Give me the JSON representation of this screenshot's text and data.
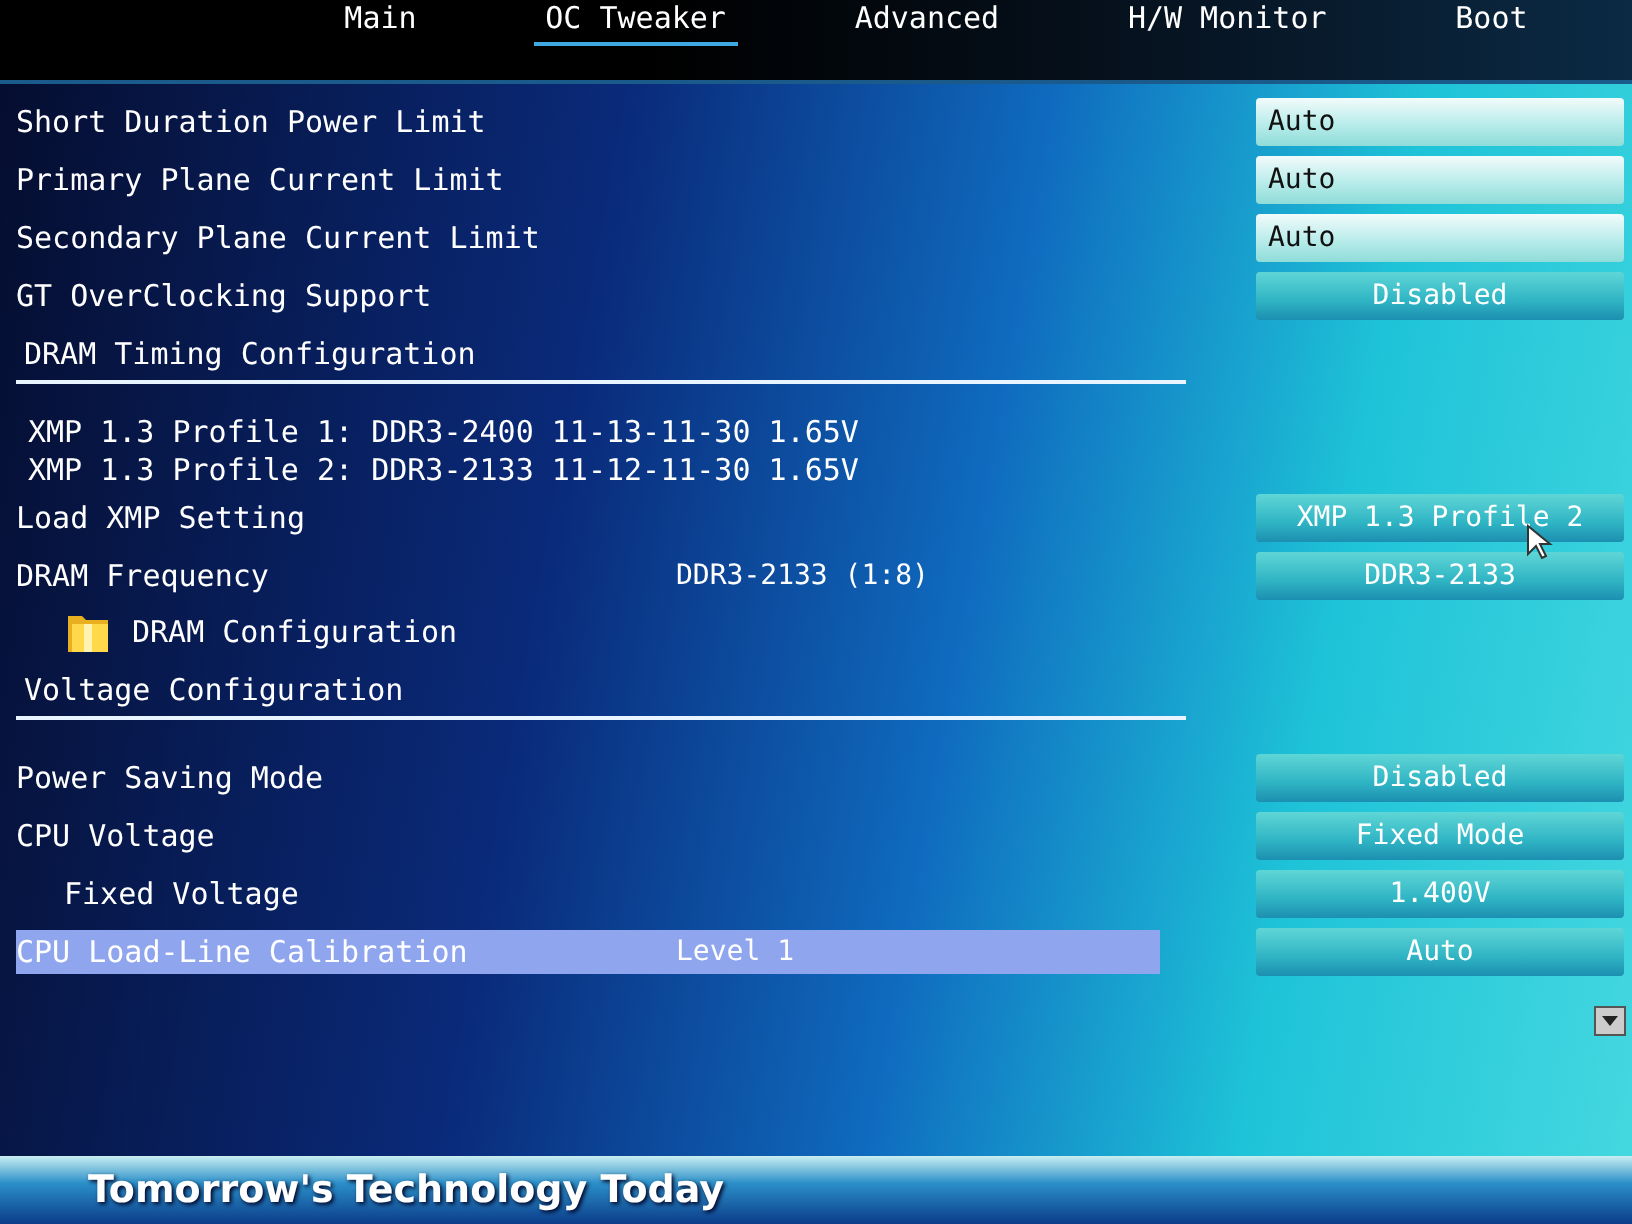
{
  "tabs": [
    {
      "label": "Main",
      "selected": false
    },
    {
      "label": "OC Tweaker",
      "selected": true
    },
    {
      "label": "Advanced",
      "selected": false
    },
    {
      "label": "H/W Monitor",
      "selected": false
    },
    {
      "label": "Boot",
      "selected": false
    }
  ],
  "items": [
    {
      "kind": "setting",
      "label": "Short Duration Power Limit",
      "selected": false,
      "option": {
        "label": "Auto",
        "kind": "field"
      }
    },
    {
      "kind": "setting",
      "label": "Primary Plane Current Limit",
      "selected": false,
      "option": {
        "label": "Auto",
        "kind": "field"
      }
    },
    {
      "kind": "setting",
      "label": "Secondary Plane Current Limit",
      "selected": false,
      "option": {
        "label": "Auto",
        "kind": "field"
      }
    },
    {
      "kind": "setting",
      "label": "GT OverClocking Support",
      "selected": false,
      "option": {
        "label": "Disabled",
        "kind": "choice"
      }
    },
    {
      "kind": "section",
      "label": "DRAM Timing Configuration"
    },
    {
      "kind": "info",
      "label": "XMP 1.3 Profile 1: DDR3-2400 11-13-11-30 1.65V"
    },
    {
      "kind": "info",
      "label": "XMP 1.3 Profile 2: DDR3-2133 11-12-11-30 1.65V"
    },
    {
      "kind": "setting",
      "label": "Load XMP Setting",
      "selected": false,
      "option": {
        "label": "XMP 1.3 Profile 2",
        "kind": "choice"
      }
    },
    {
      "kind": "setting",
      "label": "DRAM Frequency",
      "value": "DDR3-2133 (1:8)",
      "selected": false,
      "option": {
        "label": "DDR3-2133",
        "kind": "choice"
      }
    },
    {
      "kind": "submenu",
      "label": "DRAM Configuration"
    },
    {
      "kind": "section",
      "label": "Voltage Configuration"
    },
    {
      "kind": "setting",
      "label": "Power Saving Mode",
      "selected": false,
      "option": {
        "label": "Disabled",
        "kind": "choice"
      }
    },
    {
      "kind": "setting",
      "label": "CPU Voltage",
      "selected": false,
      "option": {
        "label": "Fixed Mode",
        "kind": "choice"
      },
      "children": [
        {
          "kind": "setting",
          "label": "Fixed Voltage",
          "selected": false,
          "option": {
            "label": "1.400V",
            "kind": "choice"
          }
        }
      ]
    },
    {
      "kind": "setting",
      "label": "CPU Load-Line Calibration",
      "value": "Level 1",
      "selected": true,
      "option": {
        "label": "Auto",
        "kind": "choice"
      }
    }
  ],
  "footer": {
    "slogan": "Tomorrow's Technology Today"
  }
}
